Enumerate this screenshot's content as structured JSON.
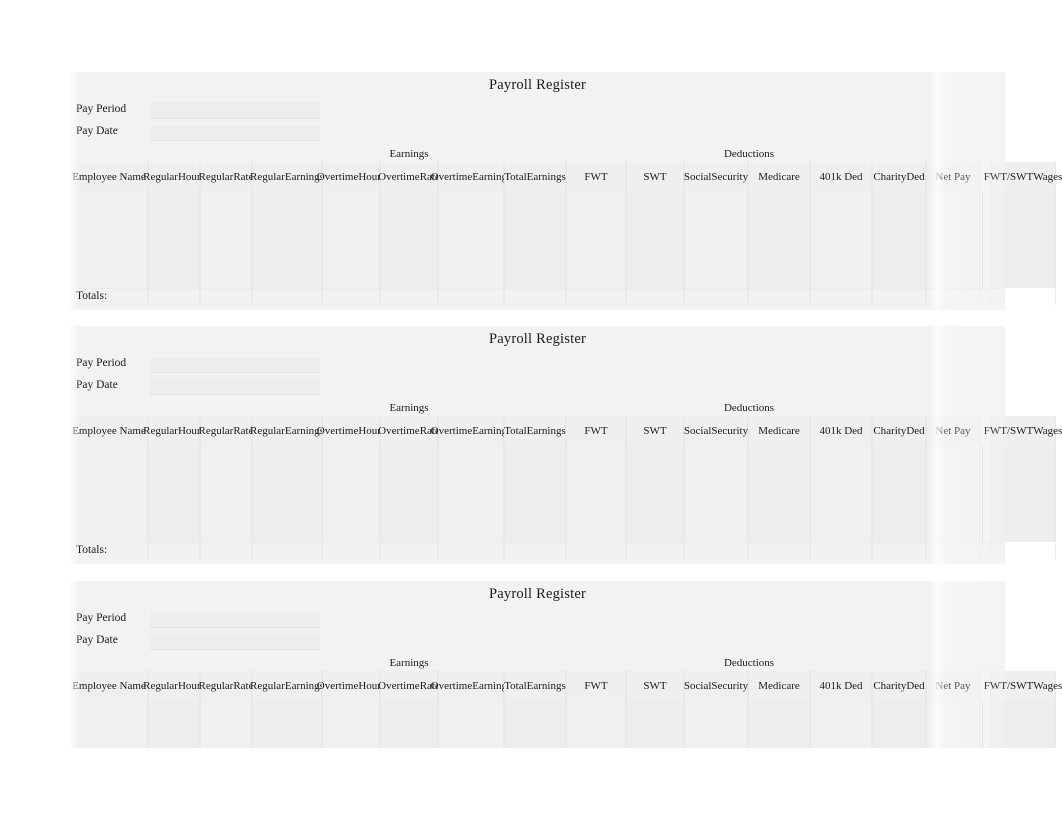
{
  "document": {
    "title": "Payroll Register",
    "block_count": 3
  },
  "meta_fields": [
    {
      "label": "Pay Period",
      "value": ""
    },
    {
      "label": "Pay Date",
      "value": ""
    }
  ],
  "groups": [
    {
      "label": "Earnings"
    },
    {
      "label": "Deductions"
    }
  ],
  "columns": [
    {
      "id": "employee-name",
      "line1": "Employee Name",
      "line2": ""
    },
    {
      "id": "regular-hours",
      "line1": "Regular",
      "line2": "Hours"
    },
    {
      "id": "regular-rate",
      "line1": "Regular",
      "line2": "Rate"
    },
    {
      "id": "regular-earnings",
      "line1": "Regular",
      "line2": "Earnings"
    },
    {
      "id": "overtime-hours",
      "line1": "Overtime",
      "line2": "Hours"
    },
    {
      "id": "overtime-rate",
      "line1": "Overtime",
      "line2": "Rate"
    },
    {
      "id": "overtime-earnings",
      "line1": "Overtime",
      "line2": "Earnings"
    },
    {
      "id": "total-earnings",
      "line1": "Total",
      "line2": "Earnings"
    },
    {
      "id": "fwt",
      "line1": "FWT",
      "line2": ""
    },
    {
      "id": "swt",
      "line1": "SWT",
      "line2": ""
    },
    {
      "id": "social-security",
      "line1": "Social",
      "line2": "Security"
    },
    {
      "id": "medicare",
      "line1": "Medicare",
      "line2": ""
    },
    {
      "id": "401k-ded",
      "line1": "401k Ded",
      "line2": ""
    },
    {
      "id": "charity-ded",
      "line1": "Charity",
      "line2": "Ded"
    },
    {
      "id": "net-pay",
      "line1": "Net Pay",
      "line2": ""
    },
    {
      "id": "fwt-swt-wages",
      "line1": "FWT/SWT",
      "line2": "Wages"
    }
  ],
  "totals": {
    "label": "Totals:"
  },
  "rows": [],
  "colors": {
    "page_background": "#ffffff",
    "block_background": "#f2f2f2",
    "cell_background": "#f0f0f0",
    "gridline": "#e8e8e8",
    "text": "#1b1b1b"
  }
}
